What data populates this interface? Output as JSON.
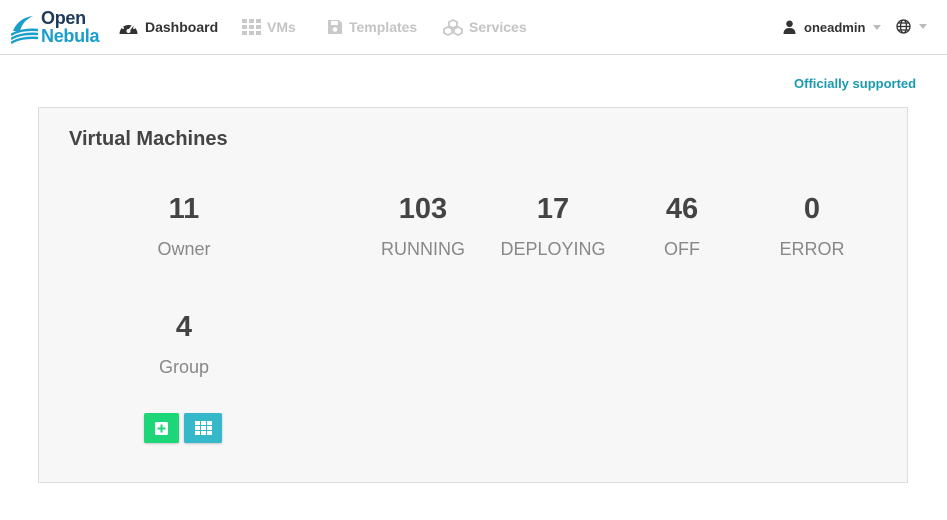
{
  "brand": {
    "line1": "Open",
    "line2": "Nebula"
  },
  "nav": {
    "dashboard": {
      "label": "Dashboard",
      "icon": "dashboard-gauge-icon"
    },
    "vms": {
      "label": "VMs",
      "icon": "grid-icon"
    },
    "templates": {
      "label": "Templates",
      "icon": "save-icon"
    },
    "services": {
      "label": "Services",
      "icon": "cubes-icon"
    }
  },
  "user": {
    "name": "oneadmin",
    "icon": "user-icon"
  },
  "language": {
    "icon": "globe-icon"
  },
  "support": {
    "label": "Officially supported"
  },
  "vm_panel": {
    "title": "Virtual Machines",
    "owner": {
      "value": "11",
      "label": "Owner"
    },
    "group": {
      "value": "4",
      "label": "Group"
    },
    "states": [
      {
        "value": "103",
        "label": "RUNNING"
      },
      {
        "value": "17",
        "label": "DEPLOYING"
      },
      {
        "value": "46",
        "label": "OFF"
      },
      {
        "value": "0",
        "label": "ERROR"
      }
    ],
    "buttons": {
      "create": {
        "icon": "plus-square-icon",
        "color": "#1ed67a"
      },
      "list": {
        "icon": "grid-icon",
        "color": "#35b8c9"
      }
    }
  },
  "colors": {
    "accent": "#1a9ab0",
    "brand_dark": "#1f3b5a",
    "brand_blue": "#1a9ecc"
  }
}
